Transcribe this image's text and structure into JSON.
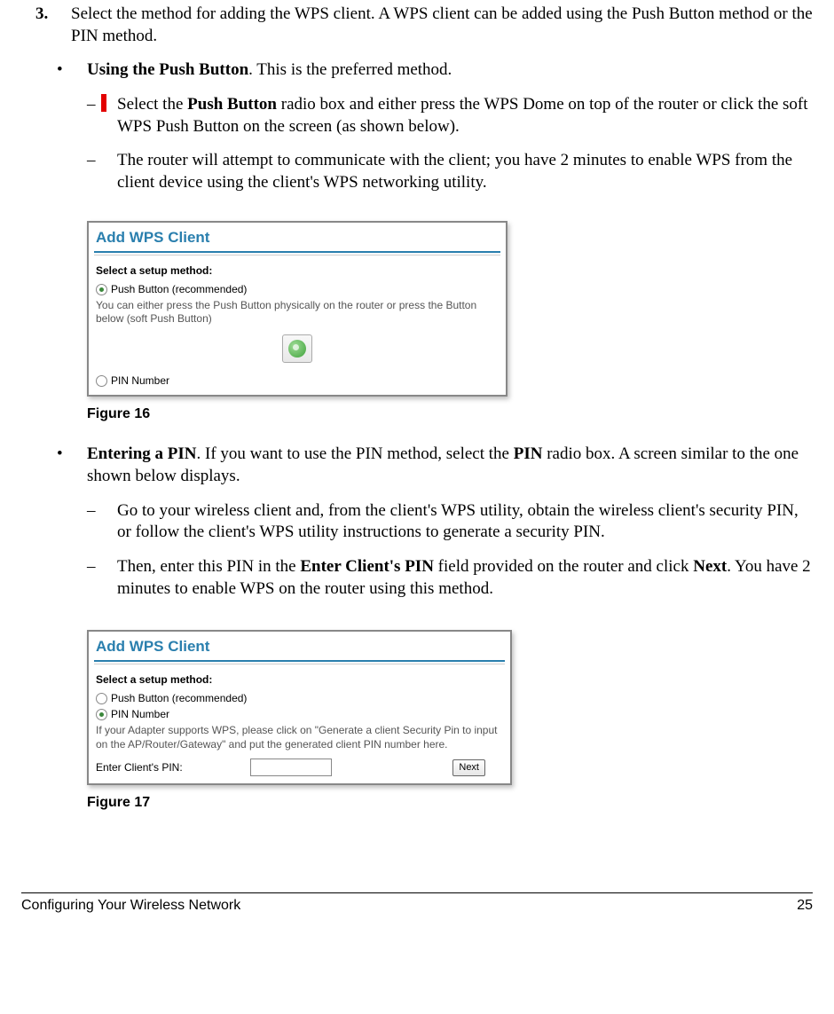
{
  "step3": {
    "number": "3.",
    "text_part1": "Select the method for adding the WPS client. A WPS client can be added using the Push Button method or the PIN method."
  },
  "push_button": {
    "title_bold": "Using the Push Button",
    "title_rest": ". This is the preferred method.",
    "dash1_a": "Select the ",
    "dash1_b": "Push Button",
    "dash1_c": " radio box and either press the WPS Dome on top of the router or click the soft WPS Push Button on the screen (as shown below).",
    "dash2": "The router will attempt to communicate with the client; you have 2 minutes to enable WPS from the client device using the client's WPS networking utility."
  },
  "fig1": {
    "title": "Add WPS Client",
    "section_label": "Select a setup method:",
    "radio1": "Push Button (recommended)",
    "desc": "You can either press the Push Button physically on the router or press the Button below (soft Push Button)",
    "radio2": "PIN Number",
    "caption": "Figure 16"
  },
  "pin": {
    "title_bold": "Entering a PIN",
    "title_rest_a": ". If you want to use the PIN method, select the ",
    "title_rest_b": "PIN",
    "title_rest_c": " radio box. A screen similar to the one shown below displays.",
    "dash1": "Go to your wireless client and, from the client's WPS utility, obtain the wireless client's security PIN, or follow the client's WPS utility instructions to generate a security PIN.",
    "dash2_a": "Then, enter this PIN in the ",
    "dash2_b": "Enter Client's PIN",
    "dash2_c": " field provided on the router and click ",
    "dash2_d": "Next",
    "dash2_e": ". You have 2 minutes to enable WPS on the router using this method."
  },
  "fig2": {
    "title": "Add WPS Client",
    "section_label": "Select a setup method:",
    "radio1": "Push Button (recommended)",
    "radio2": "PIN Number",
    "desc": "If your Adapter supports WPS, please click on \"Generate a client Security Pin to input on the AP/Router/Gateway\" and put the generated client PIN number here.",
    "pin_label": "Enter Client's PIN:",
    "next": "Next",
    "caption": "Figure 17"
  },
  "footer": {
    "left": "Configuring Your Wireless Network",
    "right": "25"
  }
}
